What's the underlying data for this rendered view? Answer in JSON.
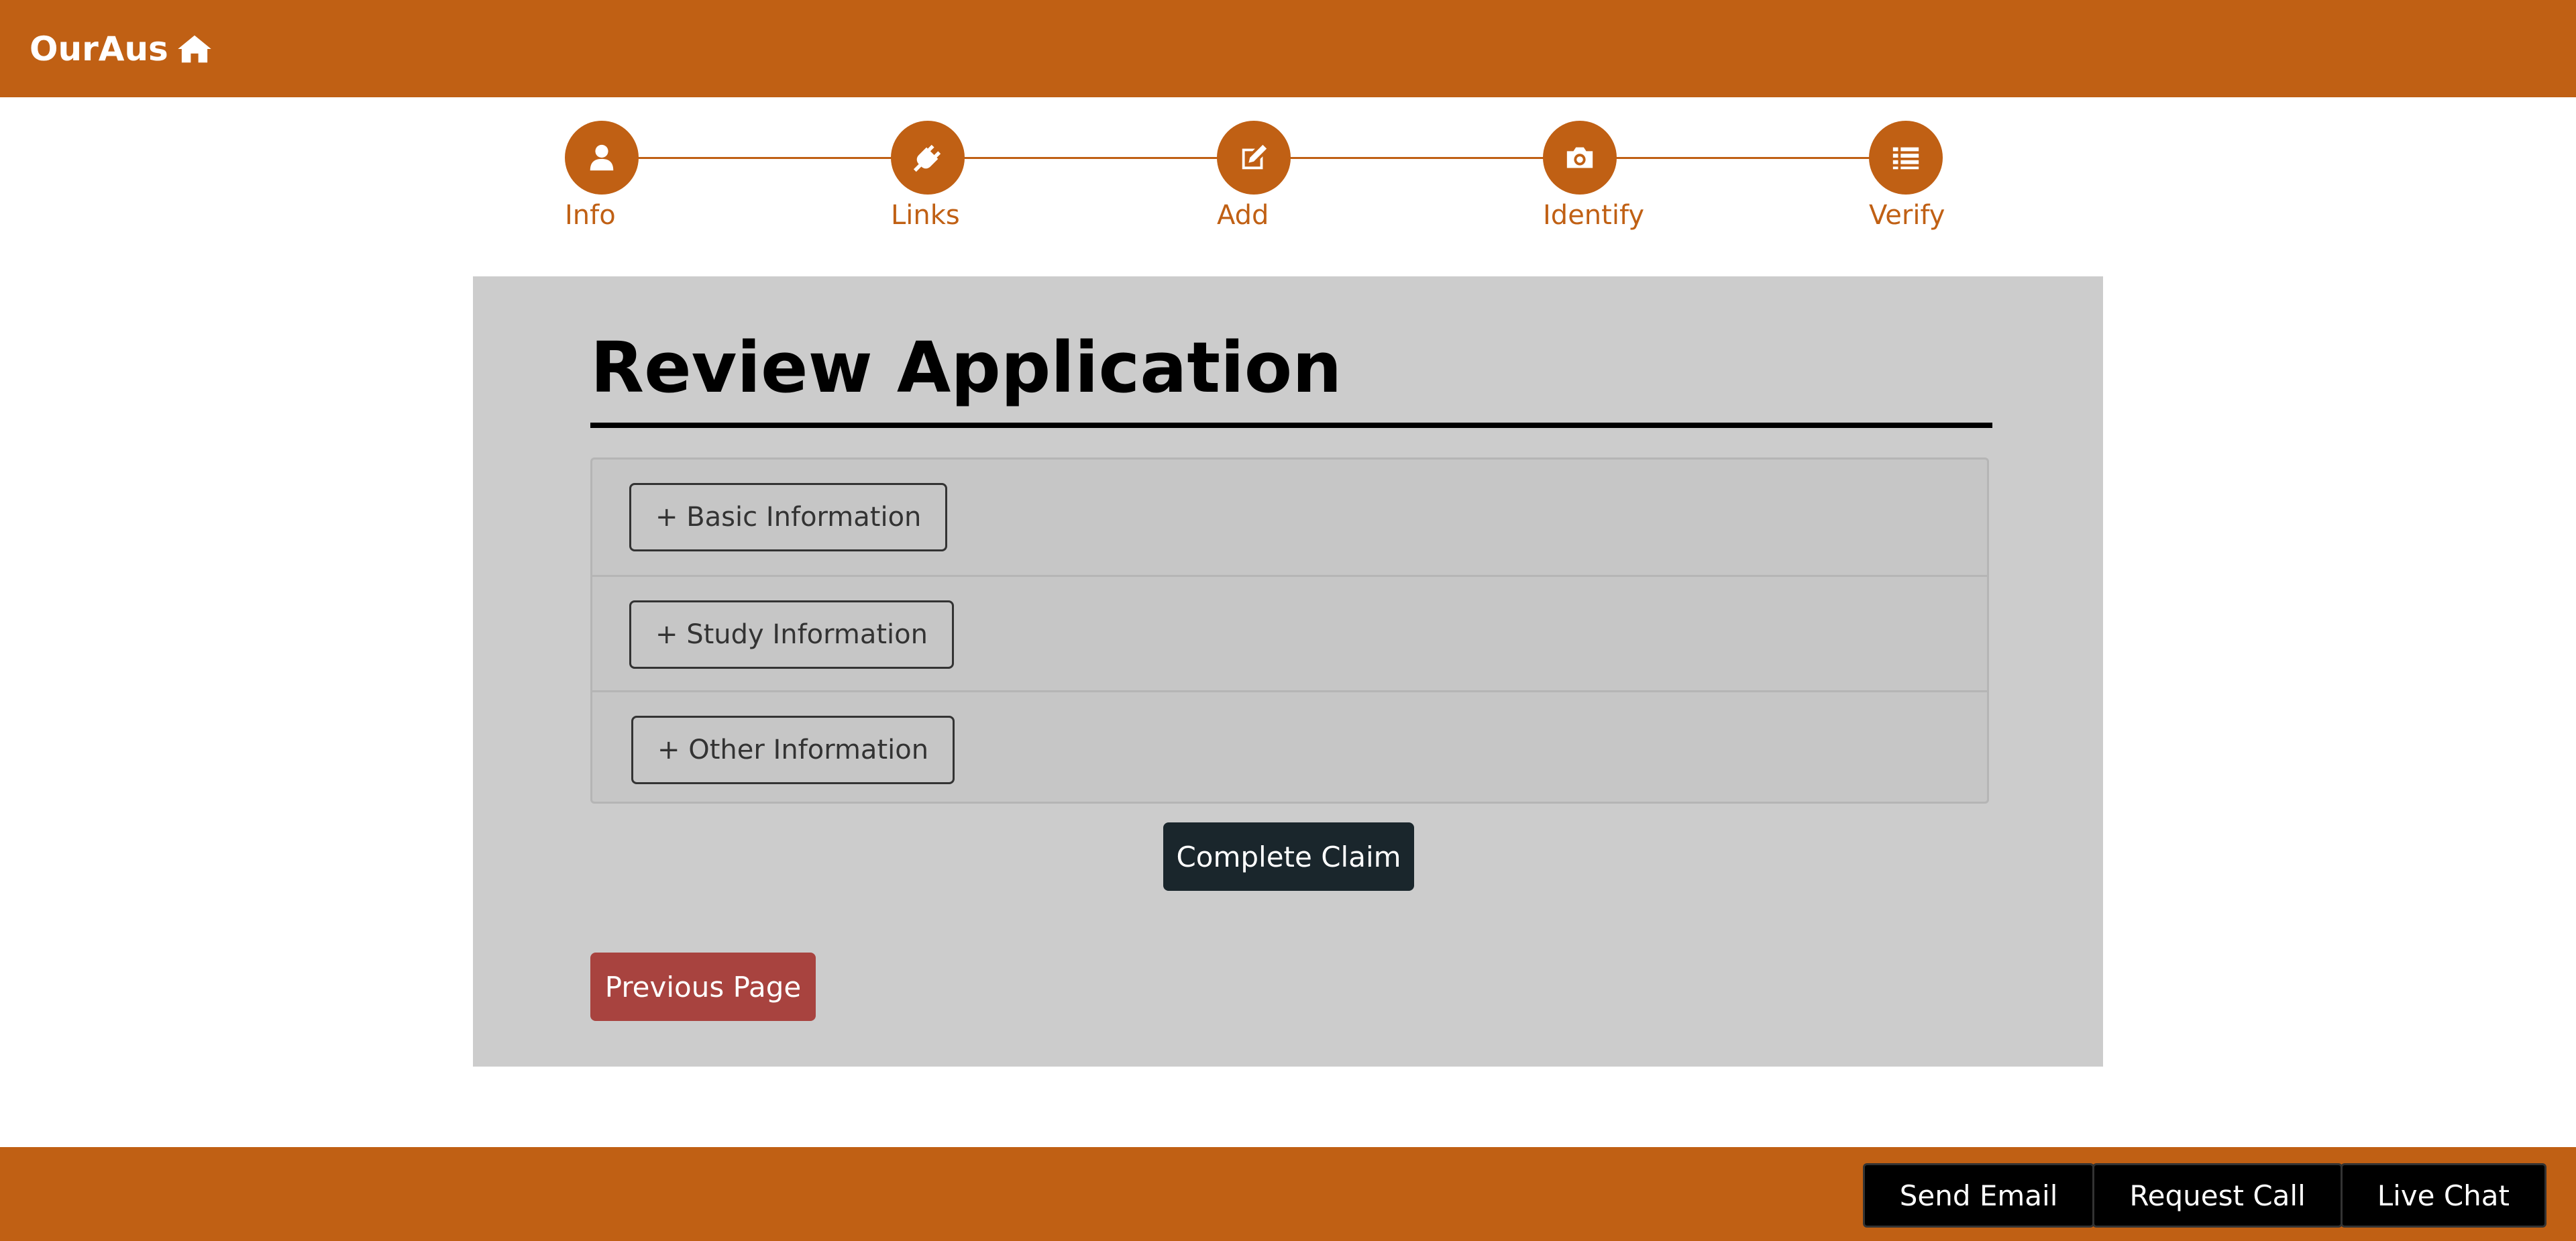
{
  "header": {
    "brand": "OurAus",
    "brand_icon": "home-icon"
  },
  "stepper": {
    "steps": [
      {
        "label": "Info",
        "icon": "user-icon"
      },
      {
        "label": "Links",
        "icon": "plug-icon"
      },
      {
        "label": "Add",
        "icon": "edit-icon"
      },
      {
        "label": "Identify",
        "icon": "camera-icon"
      },
      {
        "label": "Verify",
        "icon": "list-icon"
      }
    ]
  },
  "main": {
    "title": "Review Application",
    "sections": [
      {
        "label": "+ Basic Information"
      },
      {
        "label": "+ Study Information"
      },
      {
        "label": "+ Other Information"
      }
    ],
    "complete_label": "Complete Claim",
    "previous_label": "Previous Page"
  },
  "footer": {
    "actions": [
      {
        "label": "Send Email"
      },
      {
        "label": "Request Call"
      },
      {
        "label": "Live Chat"
      }
    ]
  },
  "colors": {
    "brand": "#c06014",
    "panel": "#cccccc",
    "primary_button": "#1a262c",
    "danger_button": "#a8433f",
    "footer_button": "#000000"
  }
}
